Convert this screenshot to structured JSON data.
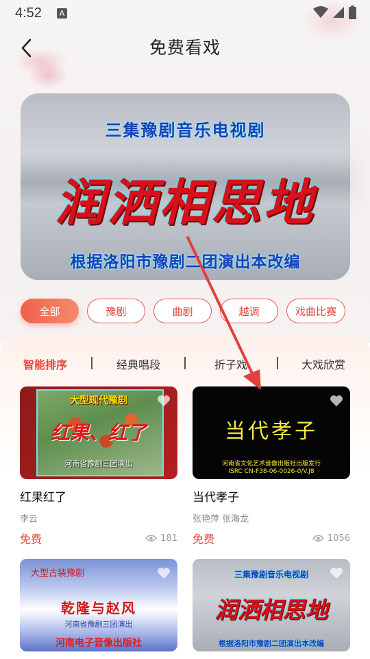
{
  "status_bar": {
    "time": "4:52",
    "notification_letter": "A"
  },
  "header": {
    "title": "免费看戏"
  },
  "banner": {
    "line1": "三集豫剧音乐电视剧",
    "main": "润洒相思地",
    "line3": "根据洛阳市豫剧二团演出本改编"
  },
  "categories": [
    "全部",
    "豫剧",
    "曲剧",
    "越调",
    "戏曲比赛"
  ],
  "sort_tabs": [
    "智能排序",
    "经典唱段",
    "折子戏",
    "大戏欣赏"
  ],
  "cards": [
    {
      "title": "红果红了",
      "artist": "李云",
      "price": "免费",
      "views": "181",
      "thumb_text": [
        "大型现代豫剧",
        "红果、红了",
        "河南省豫剧三团演出"
      ]
    },
    {
      "title": "当代孝子",
      "artist": "张艳萍 张海龙",
      "price": "免费",
      "views": "1056",
      "thumb_text": [
        "当代孝子",
        "河南省文化艺术音像出版社出版发行",
        "ISRC CN-F38-06-0026-0/V.J8"
      ]
    },
    {
      "thumb_text": [
        "大型古装豫剧",
        "乾隆与赵风",
        "河南省豫剧三团演出",
        "河南电子音像出版社"
      ]
    },
    {
      "thumb_text": [
        "三集豫剧音乐电视剧",
        "润洒相思地",
        "根据洛阳市豫剧二团演出本改编"
      ]
    }
  ],
  "colors": {
    "accent": "#e5483a",
    "chip_gradient_start": "#f0614b",
    "chip_gradient_end": "#f58a6e"
  }
}
